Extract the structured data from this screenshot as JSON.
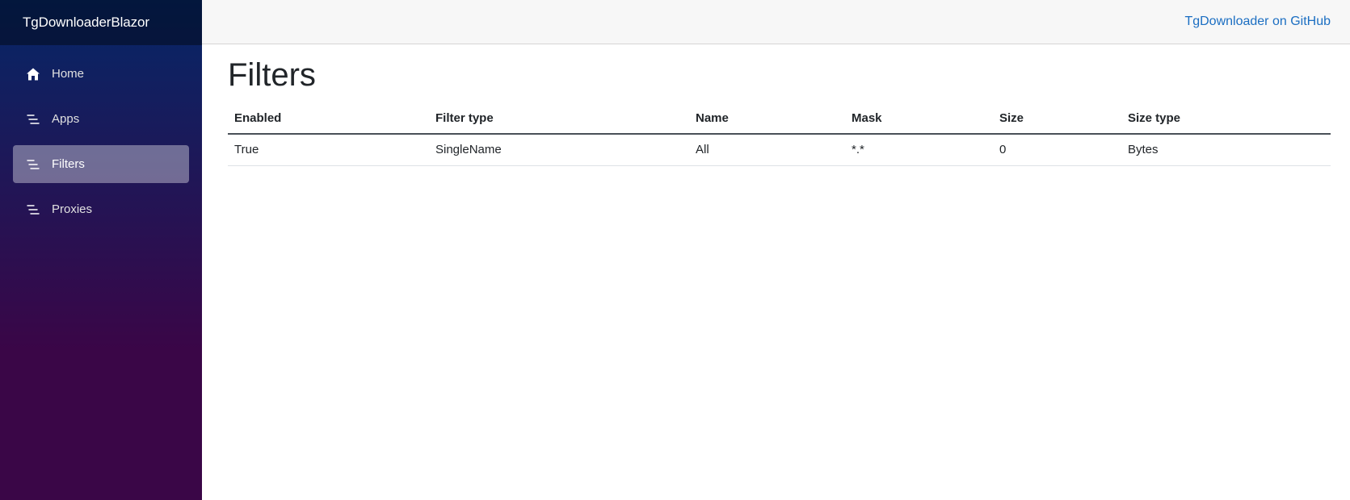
{
  "app": {
    "brand": "TgDownloaderBlazor"
  },
  "header": {
    "github_link": "TgDownloader on GitHub"
  },
  "sidebar": {
    "items": [
      {
        "label": "Home",
        "icon": "home-icon",
        "active": false
      },
      {
        "label": "Apps",
        "icon": "list-icon",
        "active": false
      },
      {
        "label": "Filters",
        "icon": "list-icon",
        "active": true
      },
      {
        "label": "Proxies",
        "icon": "list-icon",
        "active": false
      }
    ]
  },
  "page": {
    "title": "Filters"
  },
  "table": {
    "columns": [
      "Enabled",
      "Filter type",
      "Name",
      "Mask",
      "Size",
      "Size type"
    ],
    "rows": [
      [
        "True",
        "SingleName",
        "All",
        "*.*",
        "0",
        "Bytes"
      ]
    ]
  },
  "colors": {
    "accent_link": "#1b6ec2",
    "sidebar_top": "#052767",
    "sidebar_bottom": "#3a0647"
  }
}
